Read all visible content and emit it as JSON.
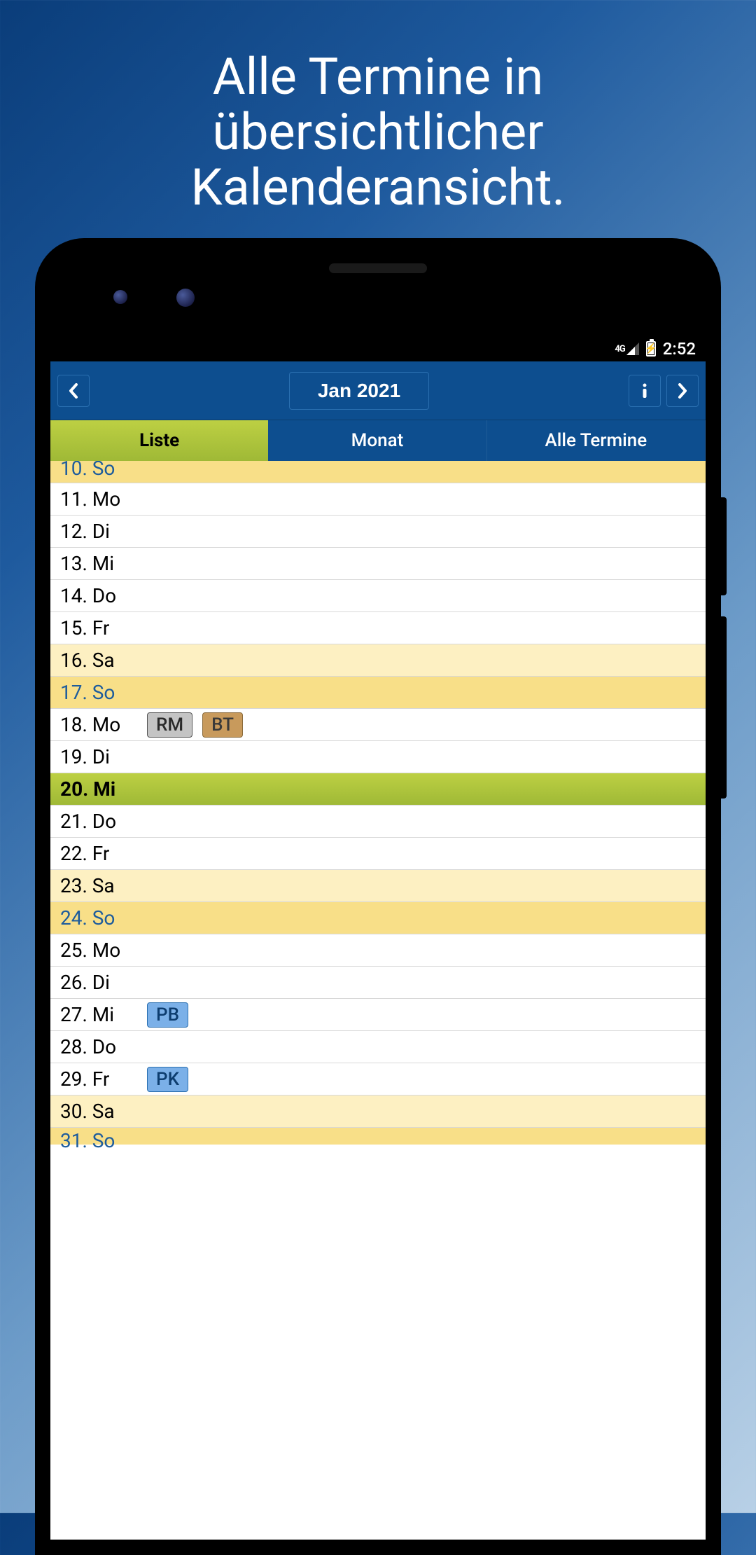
{
  "headline": "Alle Termine in übersichtlicher Kalenderansicht.",
  "status": {
    "network": "4G",
    "time": "2:52"
  },
  "header": {
    "month_label": "Jan 2021"
  },
  "tabs": {
    "liste": "Liste",
    "monat": "Monat",
    "alle": "Alle Termine"
  },
  "days": [
    {
      "label": "10. So",
      "type": "sun",
      "badges": [],
      "clip": "top"
    },
    {
      "label": "11. Mo",
      "type": "",
      "badges": []
    },
    {
      "label": "12. Di",
      "type": "",
      "badges": []
    },
    {
      "label": "13. Mi",
      "type": "",
      "badges": []
    },
    {
      "label": "14. Do",
      "type": "",
      "badges": []
    },
    {
      "label": "15. Fr",
      "type": "",
      "badges": []
    },
    {
      "label": "16. Sa",
      "type": "sat",
      "badges": []
    },
    {
      "label": "17. So",
      "type": "sun",
      "badges": []
    },
    {
      "label": "18. Mo",
      "type": "",
      "badges": [
        {
          "t": "RM",
          "c": "gray"
        },
        {
          "t": "BT",
          "c": "tan"
        }
      ]
    },
    {
      "label": "19. Di",
      "type": "",
      "badges": []
    },
    {
      "label": "20. Mi",
      "type": "today",
      "badges": []
    },
    {
      "label": "21. Do",
      "type": "",
      "badges": []
    },
    {
      "label": "22. Fr",
      "type": "",
      "badges": []
    },
    {
      "label": "23. Sa",
      "type": "sat",
      "badges": []
    },
    {
      "label": "24. So",
      "type": "sun",
      "badges": []
    },
    {
      "label": "25. Mo",
      "type": "",
      "badges": []
    },
    {
      "label": "26. Di",
      "type": "",
      "badges": []
    },
    {
      "label": "27. Mi",
      "type": "",
      "badges": [
        {
          "t": "PB",
          "c": "blue"
        }
      ]
    },
    {
      "label": "28. Do",
      "type": "",
      "badges": []
    },
    {
      "label": "29. Fr",
      "type": "",
      "badges": [
        {
          "t": "PK",
          "c": "blue"
        }
      ]
    },
    {
      "label": "30. Sa",
      "type": "sat",
      "badges": []
    },
    {
      "label": "31. So",
      "type": "sun",
      "badges": [],
      "clip": "bottom"
    }
  ]
}
